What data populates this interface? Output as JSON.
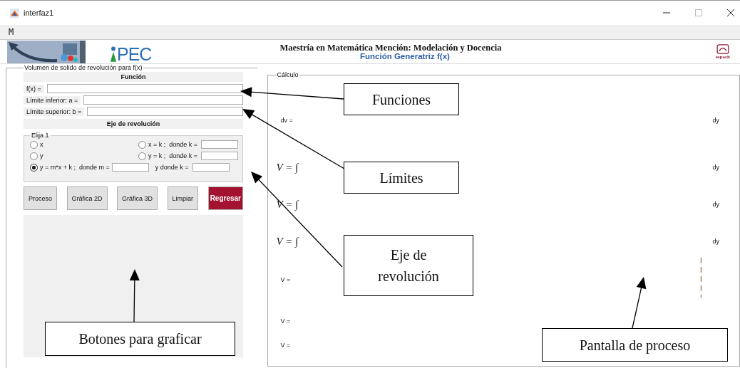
{
  "window": {
    "title": "interfaz1"
  },
  "menu": [
    "M"
  ],
  "banner": {
    "logo_text": "PEC",
    "title": "Maestría en Matemática Mención: Modelación y Docencia",
    "subtitle": "Función Generatriz f(x)",
    "right_logo_text": "espoch"
  },
  "left_panel": {
    "title": "Volumen de solido de revolución para f(x)",
    "function_header": "Función",
    "fields": [
      {
        "label": "f(x) ="
      },
      {
        "label": "Límite inferior: a ="
      },
      {
        "label": "Límite superior: b ="
      }
    ],
    "axis_header": "Eje de revolución",
    "group_title": "Elija 1",
    "options": [
      {
        "kind": "plain",
        "label": "x",
        "selected": false
      },
      {
        "kind": "field",
        "label": "x = k ;  donde k =",
        "selected": false
      },
      {
        "kind": "plain",
        "label": "y",
        "selected": false
      },
      {
        "kind": "field",
        "label": "y = k ;  donde k =",
        "selected": false
      },
      {
        "kind": "two_fields",
        "label": "y = m*x + k ;  donde m =",
        "second_label": "y donde k =",
        "selected": true
      }
    ],
    "buttons": [
      {
        "label": "Proceso",
        "kind": "normal"
      },
      {
        "label": "Gráfica 2D",
        "kind": "normal"
      },
      {
        "label": "Gráfica 3D",
        "kind": "normal"
      },
      {
        "label": "Limpiar",
        "kind": "normal"
      },
      {
        "label": "Regresar",
        "kind": "danger"
      }
    ]
  },
  "calc_panel": {
    "title": "Cálculo",
    "lines": [
      {
        "kind": "small",
        "label": "dv =",
        "suffix": "dy"
      },
      {
        "kind": "integral",
        "label": "V = ∫",
        "suffix": "dy"
      },
      {
        "kind": "integral",
        "label": "V = ∫",
        "suffix": "dy"
      },
      {
        "kind": "integral",
        "label": "V = ∫",
        "suffix": "dy"
      },
      {
        "kind": "small",
        "label": "V ="
      },
      {
        "kind": "small",
        "label": "V ="
      },
      {
        "kind": "small",
        "label": "V ="
      }
    ]
  },
  "annotations": [
    {
      "text": "Funciones"
    },
    {
      "text": "Límites"
    },
    {
      "text": "Eje de revolución"
    },
    {
      "text": "Botones para graficar"
    },
    {
      "text": "Pantalla de proceso"
    }
  ]
}
